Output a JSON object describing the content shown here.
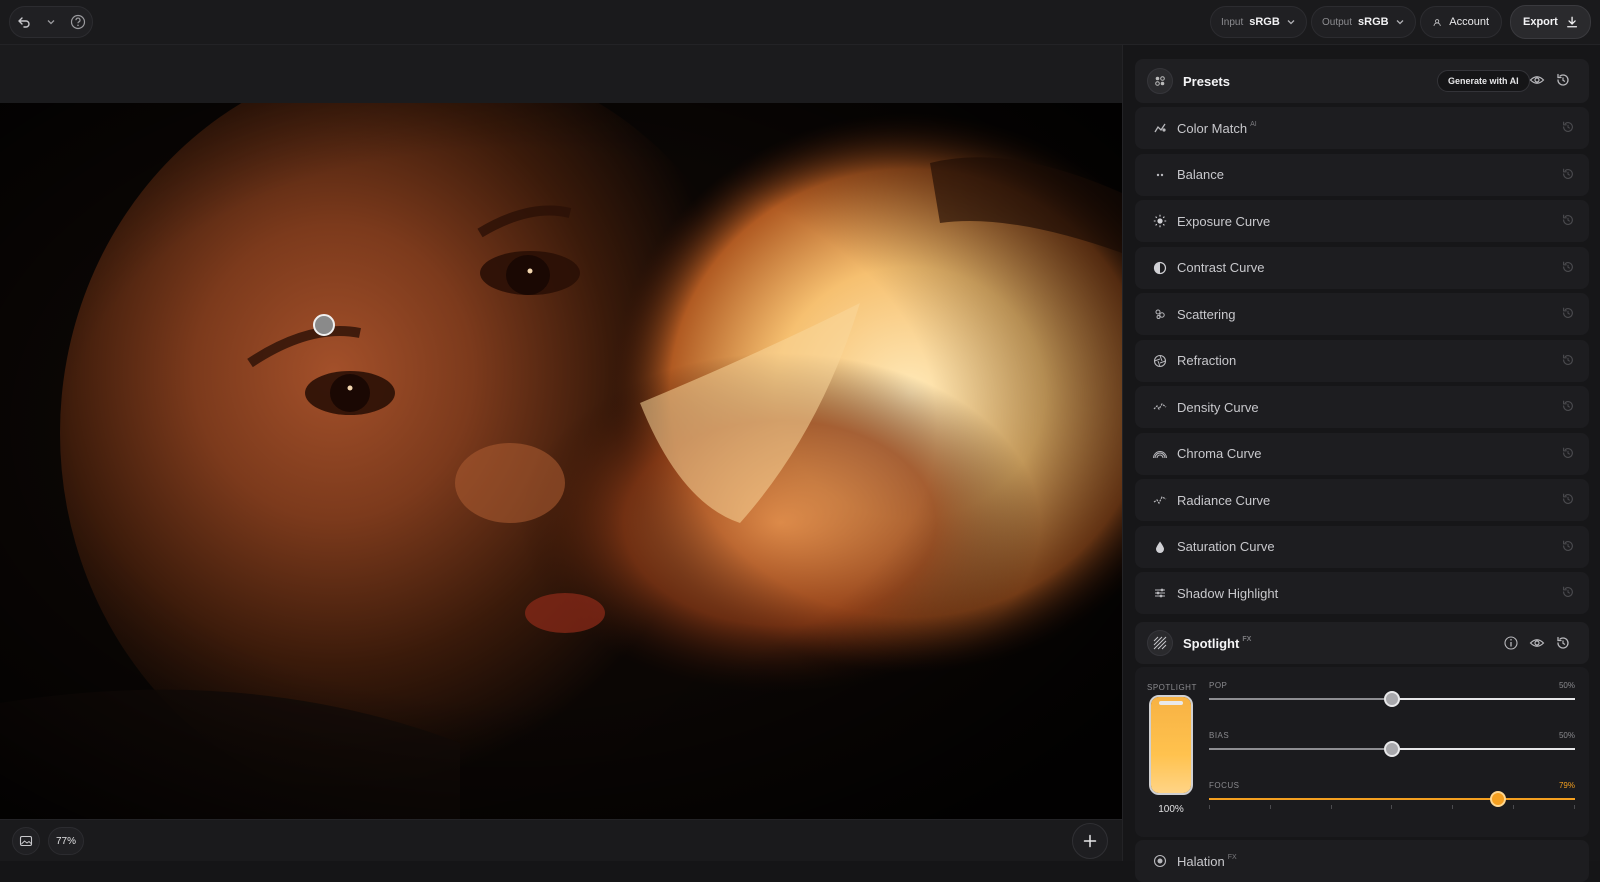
{
  "topbar": {
    "input_key": "Input",
    "input_value": "sRGB",
    "output_key": "Output",
    "output_value": "sRGB",
    "account_label": "Account",
    "export_label": "Export"
  },
  "canvas": {
    "zoom_label": "77%"
  },
  "panel": {
    "presets_label": "Presets",
    "generate_label": "Generate with AI",
    "sections": [
      {
        "label": "Color Match",
        "sup": "AI",
        "icon": "color-match-icon"
      },
      {
        "label": "Balance",
        "sup": "",
        "icon": "balance-icon"
      },
      {
        "label": "Exposure Curve",
        "sup": "",
        "icon": "sun-icon"
      },
      {
        "label": "Contrast Curve",
        "sup": "",
        "icon": "half-circle-icon"
      },
      {
        "label": "Scattering",
        "sup": "",
        "icon": "scattering-icon"
      },
      {
        "label": "Refraction",
        "sup": "",
        "icon": "aperture-icon"
      },
      {
        "label": "Density Curve",
        "sup": "",
        "icon": "density-icon"
      },
      {
        "label": "Chroma Curve",
        "sup": "",
        "icon": "rainbow-icon"
      },
      {
        "label": "Radiance Curve",
        "sup": "",
        "icon": "radiance-icon"
      },
      {
        "label": "Saturation Curve",
        "sup": "",
        "icon": "drop-icon"
      },
      {
        "label": "Shadow Highlight",
        "sup": "",
        "icon": "sliders-icon"
      }
    ],
    "spotlight": {
      "label": "Spotlight",
      "sup": "FX",
      "vertical_label": "SPOTLIGHT",
      "vertical_value": "100%",
      "vertical_level": 1.0,
      "sliders": [
        {
          "name": "POP",
          "value_text": "50%",
          "value": 0.5,
          "accent": false
        },
        {
          "name": "BIAS",
          "value_text": "50%",
          "value": 0.5,
          "accent": false
        },
        {
          "name": "FOCUS",
          "value_text": "79%",
          "value": 0.79,
          "accent": true
        }
      ]
    },
    "halation": {
      "label": "Halation",
      "sup": "FX"
    }
  },
  "colors": {
    "accent": "#f5a020",
    "panel_row": "#1d1d20"
  }
}
